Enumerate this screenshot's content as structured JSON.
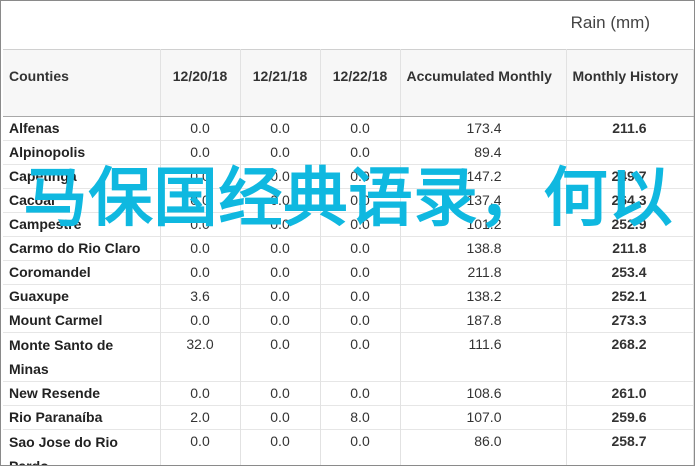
{
  "caption": "Rain (mm)",
  "headers": {
    "counties": "Counties",
    "d1": "12/20/18",
    "d2": "12/21/18",
    "d3": "12/22/18",
    "accum": "Accumulated Monthly",
    "hist": "Monthly History"
  },
  "rows": [
    {
      "county": "Alfenas",
      "d1": "0.0",
      "d2": "0.0",
      "d3": "0.0",
      "accum": "173.4",
      "hist": "211.6"
    },
    {
      "county": "Alpinopolis",
      "d1": "0.0",
      "d2": "0.0",
      "d3": "0.0",
      "accum": "89.4",
      "hist": ""
    },
    {
      "county": "Capetinga",
      "d1": "0.0",
      "d2": "0.0",
      "d3": "0.0",
      "accum": "147.2",
      "hist": "249.7"
    },
    {
      "county": "Cacoal",
      "d1": "0.0",
      "d2": "0.0",
      "d3": "0.0",
      "accum": "137.4",
      "hist": "264.3"
    },
    {
      "county": "Campestre",
      "d1": "0.0",
      "d2": "0.0",
      "d3": "0.0",
      "accum": "101.2",
      "hist": "252.9"
    },
    {
      "county": "Carmo do Rio Claro",
      "d1": "0.0",
      "d2": "0.0",
      "d3": "0.0",
      "accum": "138.8",
      "hist": "211.8"
    },
    {
      "county": "Coromandel",
      "d1": "0.0",
      "d2": "0.0",
      "d3": "0.0",
      "accum": "211.8",
      "hist": "253.4"
    },
    {
      "county": "Guaxupe",
      "d1": "3.6",
      "d2": "0.0",
      "d3": "0.0",
      "accum": "138.2",
      "hist": "252.1"
    },
    {
      "county": "Mount Carmel",
      "d1": "0.0",
      "d2": "0.0",
      "d3": "0.0",
      "accum": "187.8",
      "hist": "273.3"
    },
    {
      "county": "Monte Santo de Minas",
      "d1": "32.0",
      "d2": "0.0",
      "d3": "0.0",
      "accum": "111.6",
      "hist": "268.2"
    },
    {
      "county": "New Resende",
      "d1": "0.0",
      "d2": "0.0",
      "d3": "0.0",
      "accum": "108.6",
      "hist": "261.0"
    },
    {
      "county": "Rio Paranaíba",
      "d1": "2.0",
      "d2": "0.0",
      "d3": "8.0",
      "accum": "107.0",
      "hist": "259.6"
    },
    {
      "county": "Sao Jose do Rio Pardo",
      "d1": "0.0",
      "d2": "0.0",
      "d3": "0.0",
      "accum": "86.0",
      "hist": "258.7"
    }
  ],
  "overlay_text": "马保国经典语录，何以",
  "overlay_color": "#0fb8e0"
}
